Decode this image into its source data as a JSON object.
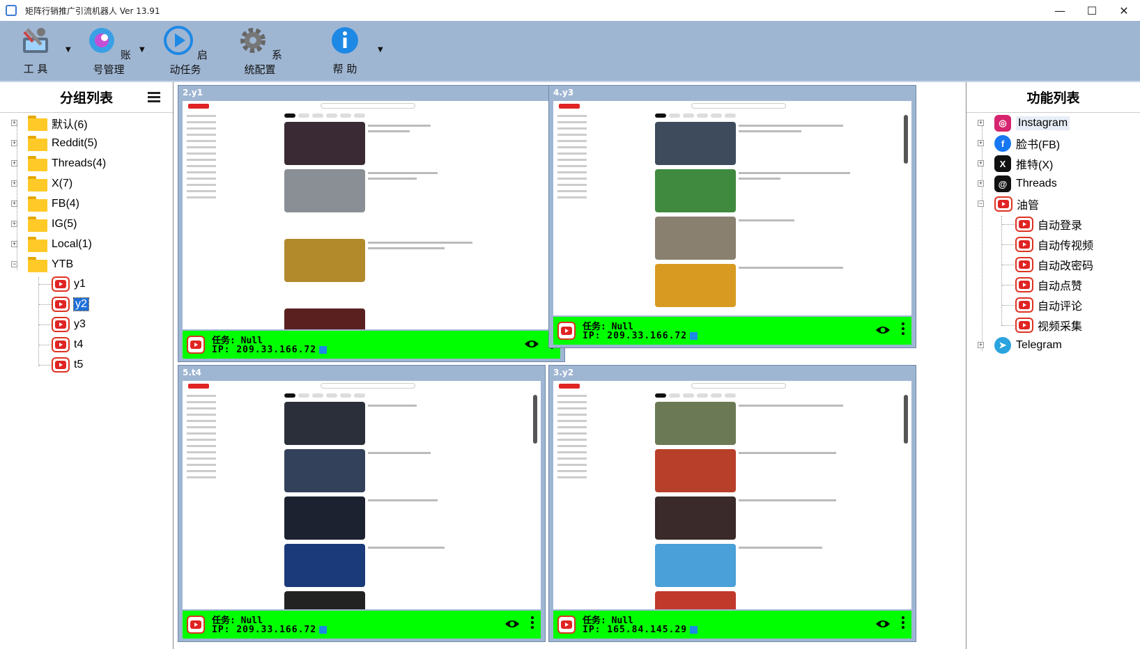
{
  "window": {
    "title": "矩阵行销推广引流机器人 Ver 13.91",
    "controls": [
      "—",
      "☐",
      "✕"
    ]
  },
  "toolbar": [
    {
      "label": "工  具",
      "icon": "tools-icon",
      "has_dropdown": true
    },
    {
      "label": "账号管理",
      "icon": "account-icon",
      "has_dropdown": true
    },
    {
      "label": "启动任务",
      "icon": "play-icon",
      "has_dropdown": false
    },
    {
      "label": "系统配置",
      "icon": "gear-icon",
      "has_dropdown": false
    },
    {
      "label": "帮  助",
      "icon": "info-icon",
      "has_dropdown": true
    }
  ],
  "group_list": {
    "title": "分组列表",
    "groups": [
      {
        "label": "默认(6)",
        "expanded": false
      },
      {
        "label": "Reddit(5)",
        "expanded": false
      },
      {
        "label": "Threads(4)",
        "expanded": false
      },
      {
        "label": "X(7)",
        "expanded": false
      },
      {
        "label": "FB(4)",
        "expanded": false
      },
      {
        "label": "IG(5)",
        "expanded": false
      },
      {
        "label": "Local(1)",
        "expanded": false
      },
      {
        "label": "YTB",
        "expanded": true
      }
    ],
    "ytb_children": [
      "y1",
      "y2",
      "y3",
      "t4",
      "t5"
    ],
    "selected": "y2"
  },
  "panes": [
    {
      "title": "2.y1",
      "task": "任务:  Null",
      "ip": "IP:  209.33.166.72"
    },
    {
      "title": "4.y3",
      "task": "任务:  Null",
      "ip": "IP:  209.33.166.72"
    },
    {
      "title": "5.t4",
      "task": "任务:  Null",
      "ip": "IP:  209.33.166.72"
    },
    {
      "title": "3.y2",
      "task": "任务:  Null",
      "ip": "IP:  165.84.145.29"
    }
  ],
  "feature_list": {
    "title": "功能列表",
    "items": [
      {
        "label": "Instagram",
        "icon": "instagram-icon",
        "color": "#d6246e",
        "level": 0
      },
      {
        "label": "脸书(FB)",
        "icon": "facebook-icon",
        "color": "#1877f2",
        "level": 0
      },
      {
        "label": "推特(X)",
        "icon": "x-icon",
        "color": "#111111",
        "level": 0
      },
      {
        "label": "Threads",
        "icon": "threads-icon",
        "color": "#111111",
        "level": 0
      },
      {
        "label": "油管",
        "icon": "youtube-icon",
        "color": "#e02424",
        "level": 0
      },
      {
        "label": "自动登录",
        "icon": "youtube-icon",
        "color": "#e02424",
        "level": 1
      },
      {
        "label": "自动传视频",
        "icon": "youtube-icon",
        "color": "#e02424",
        "level": 1
      },
      {
        "label": "自动改密码",
        "icon": "youtube-icon",
        "color": "#e02424",
        "level": 1
      },
      {
        "label": "自动点赞",
        "icon": "youtube-icon",
        "color": "#e02424",
        "level": 1
      },
      {
        "label": "自动评论",
        "icon": "youtube-icon",
        "color": "#e02424",
        "level": 1
      },
      {
        "label": "视频采集",
        "icon": "youtube-icon",
        "color": "#e02424",
        "level": 1
      },
      {
        "label": "Telegram",
        "icon": "telegram-icon",
        "color": "#2aa3de",
        "level": 0
      }
    ]
  },
  "colors": {
    "status_bar": "#00ff00",
    "toolbar_bg": "#9fb6d3",
    "accent": "#1e6fd9"
  }
}
